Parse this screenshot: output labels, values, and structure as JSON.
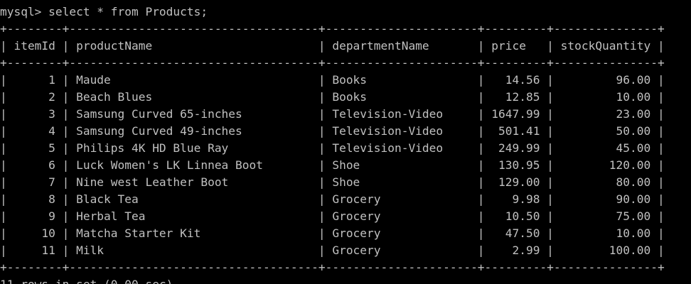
{
  "terminal": {
    "prompt": "mysql> ",
    "command": "select * from Products;",
    "columns": [
      "itemId",
      "productName",
      "departmentName",
      "price",
      "stockQuantity"
    ],
    "rows": [
      [
        "1",
        "Maude",
        "Books",
        "14.56",
        "96.00"
      ],
      [
        "2",
        "Beach Blues",
        "Books",
        "12.85",
        "10.00"
      ],
      [
        "3",
        "Samsung Curved 65-inches",
        "Television-Video",
        "1647.99",
        "23.00"
      ],
      [
        "4",
        "Samsung Curved 49-inches",
        "Television-Video",
        "501.41",
        "50.00"
      ],
      [
        "5",
        "Philips 4K HD Blue Ray",
        "Television-Video",
        "249.99",
        "45.00"
      ],
      [
        "6",
        "Luck Women's LK Linnea Boot",
        "Shoe",
        "130.95",
        "120.00"
      ],
      [
        "7",
        "Nine west Leather Boot",
        "Shoe",
        "129.00",
        "80.00"
      ],
      [
        "8",
        "Black Tea",
        "Grocery",
        "9.98",
        "90.00"
      ],
      [
        "9",
        "Herbal Tea",
        "Grocery",
        "10.50",
        "75.00"
      ],
      [
        "10",
        "Matcha Starter Kit",
        "Grocery",
        "47.50",
        "10.00"
      ],
      [
        "11",
        "Milk",
        "Grocery",
        "2.99",
        "100.00"
      ]
    ],
    "footer": "11 rows in set (0.00 sec)"
  }
}
